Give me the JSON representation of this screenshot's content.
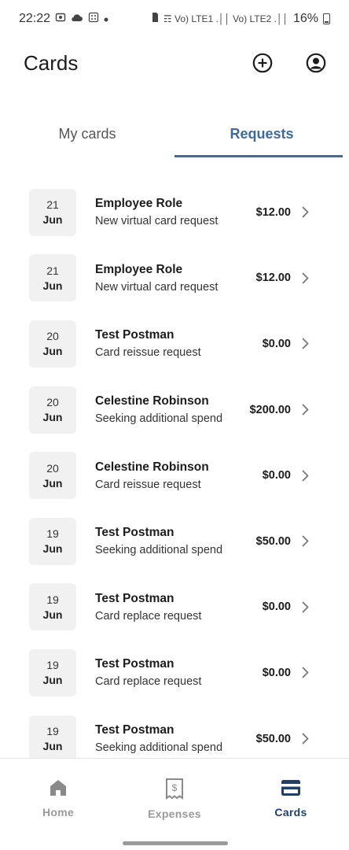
{
  "status_bar": {
    "time": "22:22",
    "left_icons": [
      "screenshot-icon",
      "cloud-icon",
      "calculator-icon",
      "dot-icon"
    ],
    "right_glyphs": "☶ Vo) LTE1 .││ Vo) LTE2 .││",
    "battery": "16%"
  },
  "header": {
    "title": "Cards"
  },
  "tabs": [
    {
      "label": "My cards",
      "active": false
    },
    {
      "label": "Requests",
      "active": true
    }
  ],
  "requests": [
    {
      "day": "21",
      "month": "Jun",
      "name": "Employee Role",
      "desc": "New virtual card request",
      "amount": "$12.00"
    },
    {
      "day": "21",
      "month": "Jun",
      "name": "Employee Role",
      "desc": "New virtual card request",
      "amount": "$12.00"
    },
    {
      "day": "20",
      "month": "Jun",
      "name": "Test Postman",
      "desc": "Card reissue request",
      "amount": "$0.00"
    },
    {
      "day": "20",
      "month": "Jun",
      "name": "Celestine Robinson",
      "desc": "Seeking additional spend",
      "amount": "$200.00"
    },
    {
      "day": "20",
      "month": "Jun",
      "name": "Celestine Robinson",
      "desc": "Card reissue request",
      "amount": "$0.00"
    },
    {
      "day": "19",
      "month": "Jun",
      "name": "Test Postman",
      "desc": "Seeking additional spend",
      "amount": "$50.00"
    },
    {
      "day": "19",
      "month": "Jun",
      "name": "Test Postman",
      "desc": "Card replace request",
      "amount": "$0.00"
    },
    {
      "day": "19",
      "month": "Jun",
      "name": "Test Postman",
      "desc": "Card replace request",
      "amount": "$0.00"
    },
    {
      "day": "19",
      "month": "Jun",
      "name": "Test Postman",
      "desc": "Seeking additional spend",
      "amount": "$50.00"
    }
  ],
  "bottom_nav": [
    {
      "label": "Home",
      "icon": "home-icon",
      "active": false
    },
    {
      "label": "Expenses",
      "icon": "receipt-icon",
      "active": false
    },
    {
      "label": "Cards",
      "icon": "credit-card-icon",
      "active": true
    }
  ],
  "colors": {
    "accent": "#3f6b9c",
    "nav_active": "#1f3f66",
    "date_box": "#f1f1f1"
  }
}
